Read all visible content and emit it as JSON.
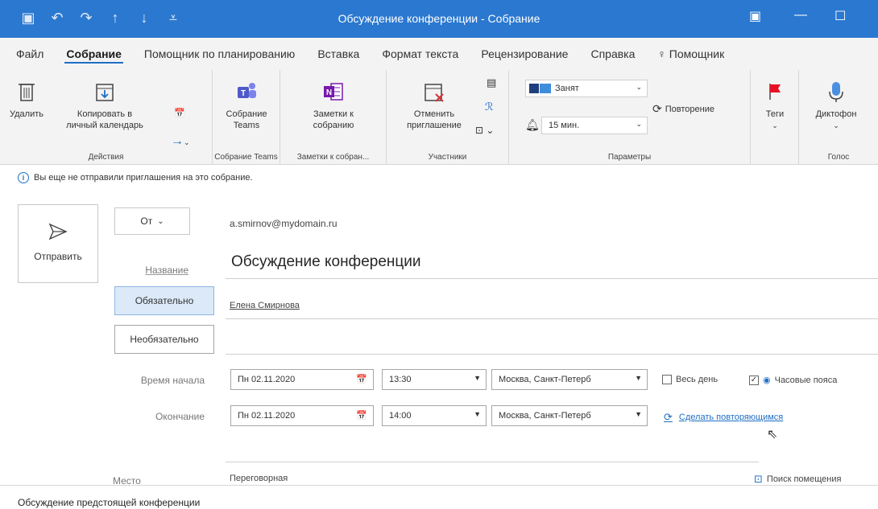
{
  "window": {
    "title": "Обсуждение конференции - Собрание"
  },
  "tabs": [
    "Файл",
    "Собрание",
    "Помощник по планированию",
    "Вставка",
    "Формат текста",
    "Рецензирование",
    "Справка",
    "Помощник"
  ],
  "ribbon": {
    "actions": {
      "delete": "Удалить",
      "copy_line1": "Копировать в",
      "copy_line2": "личный календарь",
      "label": "Действия"
    },
    "teams": {
      "btn_line1": "Собрание",
      "btn_line2": "Teams",
      "label": "Собрание Teams"
    },
    "notes": {
      "btn_line1": "Заметки к",
      "btn_line2": "собранию",
      "label": "Заметки к собран..."
    },
    "attendees": {
      "btn_line1": "Отменить",
      "btn_line2": "приглашение",
      "label": "Участники"
    },
    "options": {
      "show_as": "Занят",
      "reminder": "15 мин.",
      "recurrence": "Повторение",
      "label": "Параметры"
    },
    "tags": {
      "btn": "Теги"
    },
    "voice": {
      "btn": "Диктофон",
      "label": "Голос"
    }
  },
  "info_message": "Вы еще не отправили приглашения на это собрание.",
  "form": {
    "send": "Отправить",
    "from_btn": "От",
    "from_value": "a.smirnov@mydomain.ru",
    "subject_label": "Название",
    "subject_value": "Обсуждение конференции",
    "required_btn": "Обязательно",
    "required_value": "Елена Смирнова",
    "optional_btn": "Необязательно",
    "start_label": "Время начала",
    "end_label": "Окончание",
    "start_date": "Пн 02.11.2020",
    "start_time": "13:30",
    "end_date": "Пн 02.11.2020",
    "end_time": "14:00",
    "timezone": "Москва, Санкт-Петерб",
    "all_day": "Весь день",
    "time_zones": "Часовые пояса",
    "make_recurring": "Сделать повторяющимся",
    "location_label": "Место",
    "location_value": "Переговорная",
    "room_finder": "Поиск помещения"
  },
  "body_text": "Обсуждение предстоящей конференции"
}
